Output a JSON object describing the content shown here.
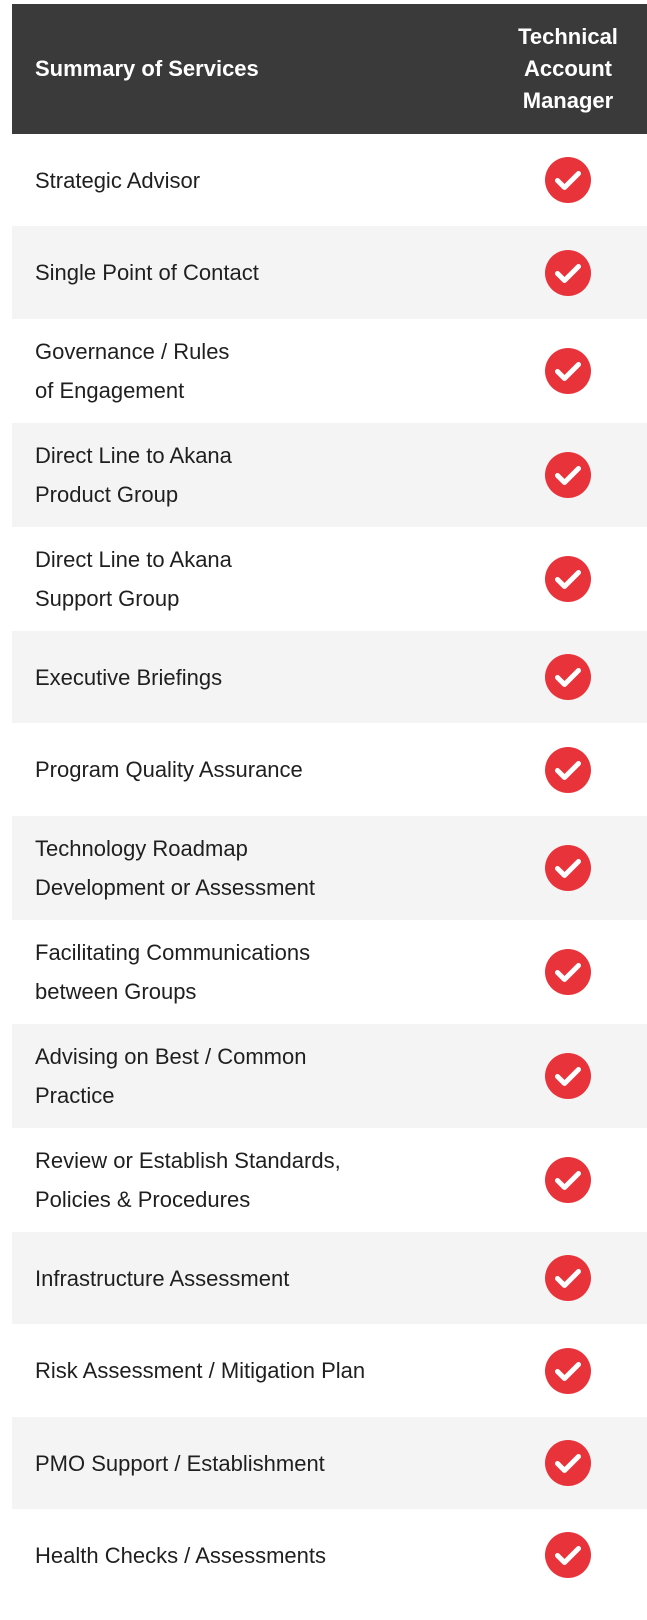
{
  "table": {
    "header": {
      "services_label": "Summary of Services",
      "column_lines": [
        "Technical",
        "Account",
        "Manager"
      ]
    },
    "rows": [
      {
        "lines": [
          "Strategic Advisor"
        ],
        "included": true
      },
      {
        "lines": [
          "Single Point of Contact"
        ],
        "included": true
      },
      {
        "lines": [
          "Governance / Rules",
          "of Engagement"
        ],
        "included": true
      },
      {
        "lines": [
          "Direct Line to Akana",
          "Product Group"
        ],
        "included": true
      },
      {
        "lines": [
          "Direct Line to Akana",
          "Support Group"
        ],
        "included": true
      },
      {
        "lines": [
          "Executive Briefings"
        ],
        "included": true
      },
      {
        "lines": [
          "Program Quality Assurance"
        ],
        "included": true
      },
      {
        "lines": [
          "Technology Roadmap",
          "Development or Assessment"
        ],
        "included": true
      },
      {
        "lines": [
          "Facilitating Communications",
          "between Groups"
        ],
        "included": true
      },
      {
        "lines": [
          "Advising on Best / Common",
          "Practice"
        ],
        "included": true
      },
      {
        "lines": [
          "Review or Establish Standards,",
          "Policies & Procedures"
        ],
        "included": true
      },
      {
        "lines": [
          "Infrastructure Assessment"
        ],
        "included": true
      },
      {
        "lines": [
          "Risk Assessment / Mitigation Plan"
        ],
        "included": true
      },
      {
        "lines": [
          "PMO Support / Establishment"
        ],
        "included": true
      },
      {
        "lines": [
          "Health Checks / Assessments"
        ],
        "included": true
      }
    ],
    "colors": {
      "header_bg": "#3a3a3a",
      "row_alt_bg": "#f4f4f4",
      "check_bg": "#e8333a",
      "check_mark": "#ffffff"
    },
    "icons": {
      "check": "check-circle-icon"
    }
  }
}
